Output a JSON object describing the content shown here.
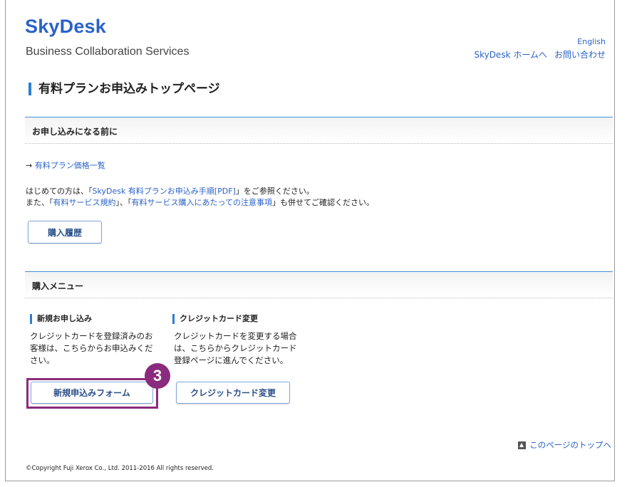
{
  "header": {
    "logo_title": "SkyDesk",
    "logo_subtitle": "Business Collaboration Services",
    "english_link": "English",
    "home_link": "SkyDesk ホームへ",
    "contact_link": "お問い合わせ"
  },
  "page_title": "有料プランお申込みトップページ",
  "section_before": {
    "title": "お申し込みになる前に",
    "price_list_arrow": "→",
    "price_list_link": "有料プラン価格一覧",
    "line1_prefix": "はじめての方は、「",
    "line1_link": "SkyDesk 有料プランお申込み手順[PDF]",
    "line1_suffix": "」をご参照ください。",
    "line2_prefix": "また、「",
    "line2_link1": "有料サービス規約",
    "line2_mid": "」、「",
    "line2_link2": "有料サービス購入にあたっての注意事項",
    "line2_suffix": "」も併せてご確認ください。",
    "history_button": "購入履歴"
  },
  "section_menu": {
    "title": "購入メニュー",
    "new": {
      "heading": "新規お申し込み",
      "description": "クレジットカードを登録済みのお客様は、こちらからお申込みください。",
      "button": "新規申込みフォーム"
    },
    "card": {
      "heading": "クレジットカード変更",
      "description": "クレジットカードを変更する場合は、こちらからクレジットカード登録ページに進んでください。",
      "button": "クレジットカード変更"
    }
  },
  "callout_number": "3",
  "footer": {
    "page_top": "このページのトップへ",
    "copyright": "©Copyright Fuji Xerox Co., Ltd. 2011-2016 All rights reserved."
  }
}
